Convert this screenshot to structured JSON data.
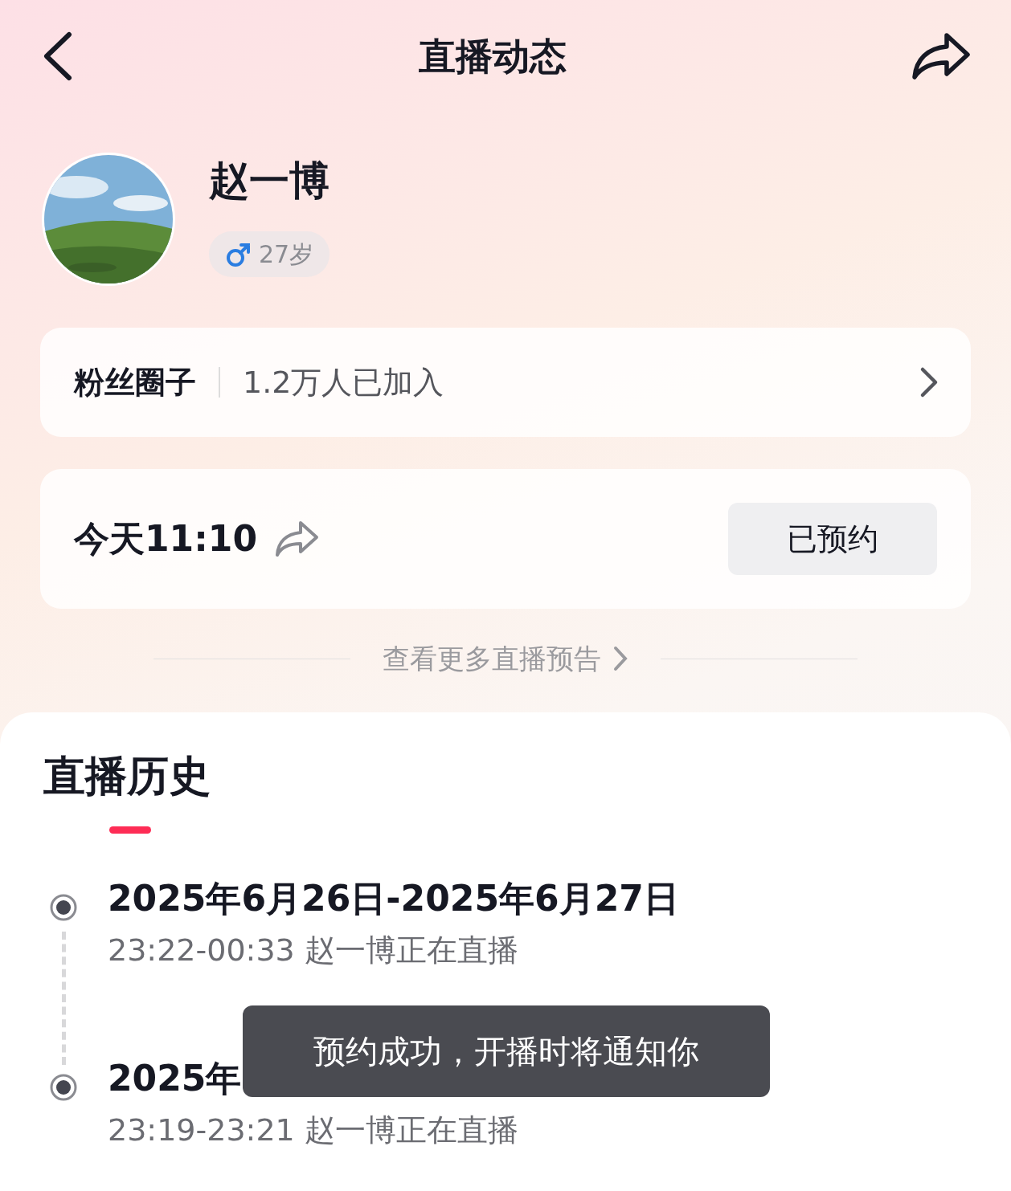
{
  "header": {
    "title": "直播动态"
  },
  "profile": {
    "name": "赵一博",
    "badge": {
      "kind": "male",
      "age": "27岁"
    }
  },
  "fan_circle": {
    "label": "粉丝圈子",
    "count": "1.2万人已加入"
  },
  "schedule": {
    "time": "今天11:10",
    "button": "已预约",
    "reserved": true
  },
  "more_link": "查看更多直播预告",
  "history": {
    "title": "直播历史",
    "entries": [
      {
        "date": "2025年6月26日-2025年6月27日",
        "detail": "23:22-00:33 赵一博正在直播"
      },
      {
        "date": "2025年",
        "detail": "23:19-23:21 赵一博正在直播"
      }
    ]
  },
  "toast": "预约成功，开播时将通知你"
}
